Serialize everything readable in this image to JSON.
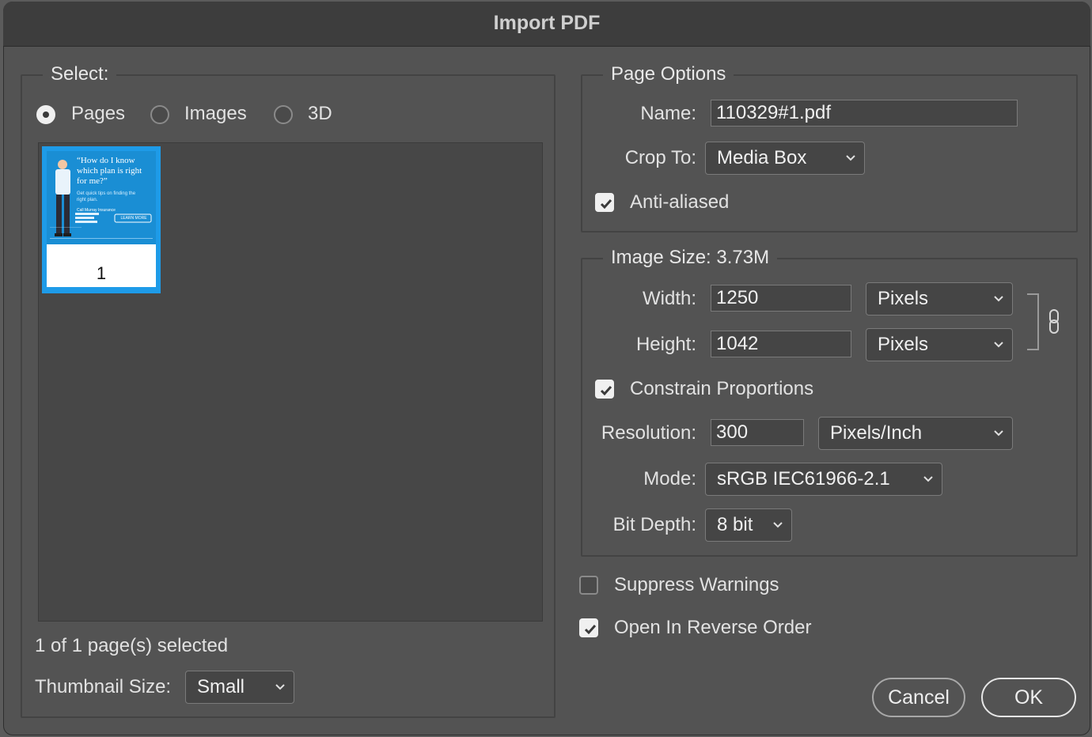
{
  "dialog": {
    "title": "Import PDF"
  },
  "select_group": {
    "legend": "Select:",
    "options": [
      {
        "label": "Pages",
        "selected": true
      },
      {
        "label": "Images",
        "selected": false
      },
      {
        "label": "3D",
        "selected": false
      }
    ],
    "thumbnail": {
      "headline": "“How do I know which plan is right for me?”",
      "subtext": "Get quick tips on finding the right plan.",
      "caption": "Call Murray Insurance",
      "cta": "LEARN MORE",
      "page_number": "1"
    },
    "status": "1 of 1 page(s) selected",
    "thumbnail_size_label": "Thumbnail Size:",
    "thumbnail_size_value": "Small"
  },
  "page_options": {
    "legend": "Page Options",
    "name_label": "Name:",
    "name_value": "110329#1.pdf",
    "crop_label": "Crop To:",
    "crop_value": "Media Box",
    "anti_aliased_label": "Anti-aliased",
    "anti_aliased_checked": true
  },
  "image_size": {
    "legend": "Image Size: 3.73M",
    "width_label": "Width:",
    "width_value": "1250",
    "width_unit": "Pixels",
    "height_label": "Height:",
    "height_value": "1042",
    "height_unit": "Pixels",
    "constrain_label": "Constrain Proportions",
    "constrain_checked": true,
    "resolution_label": "Resolution:",
    "resolution_value": "300",
    "resolution_unit": "Pixels/Inch",
    "mode_label": "Mode:",
    "mode_value": "sRGB IEC61966-2.1",
    "bitdepth_label": "Bit Depth:",
    "bitdepth_value": "8 bit"
  },
  "options": {
    "suppress_warnings_label": "Suppress Warnings",
    "suppress_warnings_checked": false,
    "reverse_order_label": "Open In Reverse Order",
    "reverse_order_checked": true
  },
  "buttons": {
    "cancel": "Cancel",
    "ok": "OK"
  },
  "colors": {
    "dialog_bg": "#535353",
    "titlebar_bg": "#3d3d3d",
    "thumbnail_accent": "#1e9be8"
  }
}
